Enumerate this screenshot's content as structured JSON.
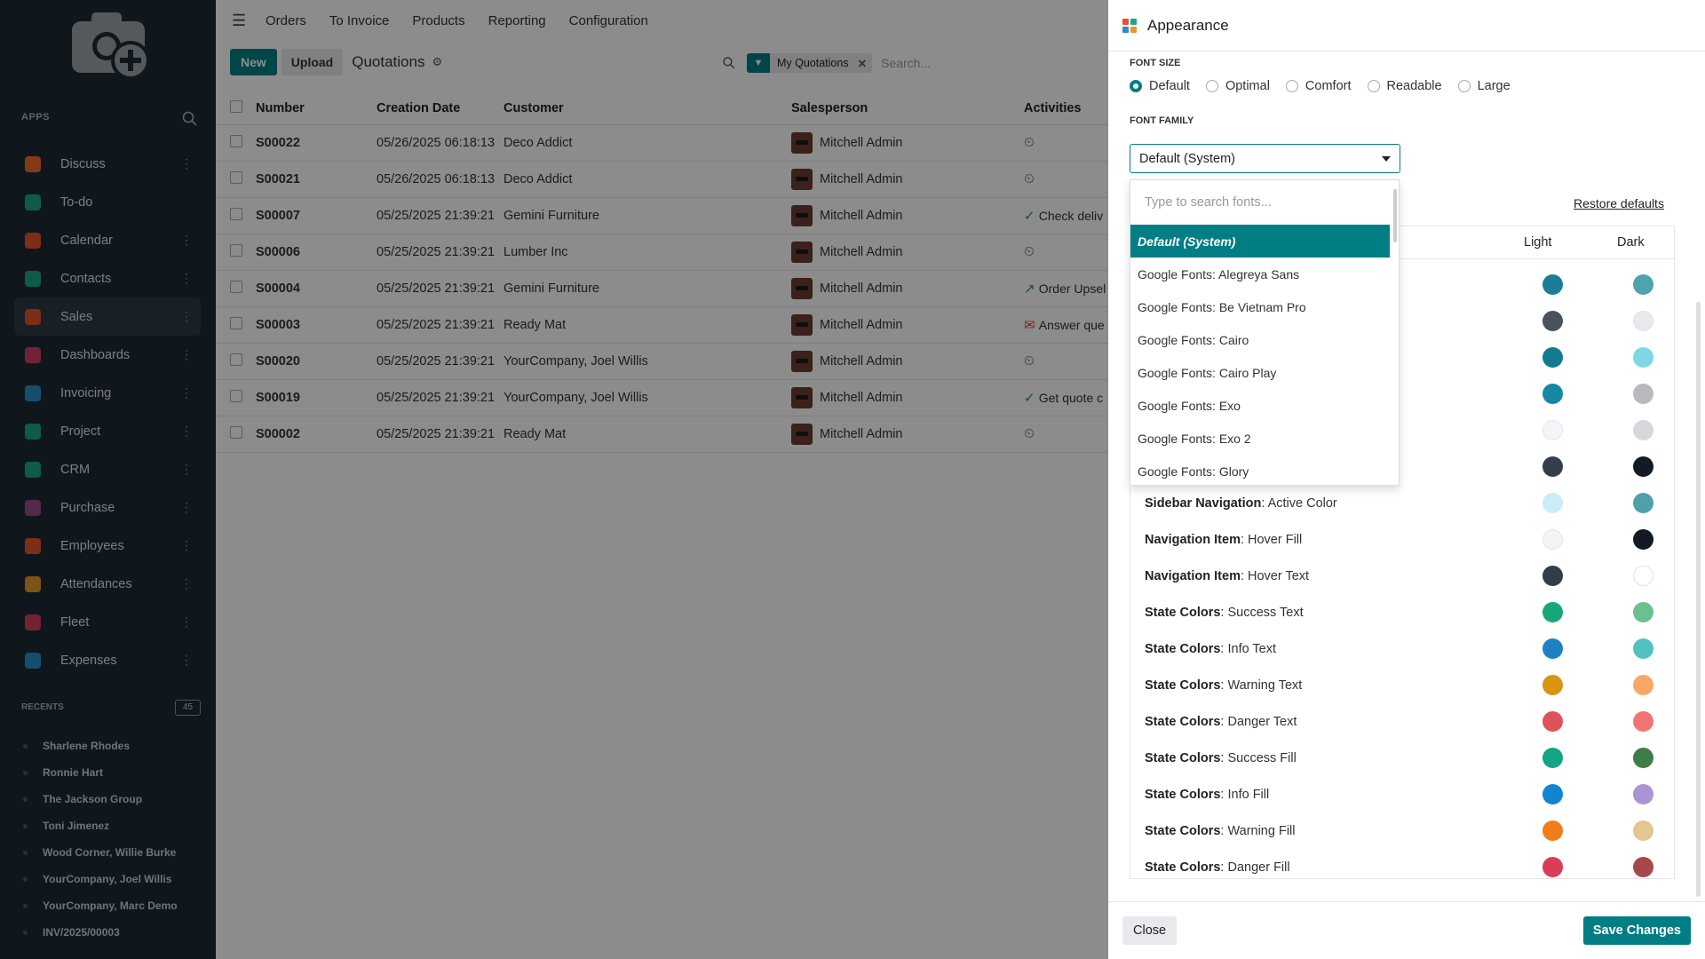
{
  "sidebar": {
    "apps_title": "APPS",
    "apps": [
      {
        "label": "Discuss",
        "color": "#f06a2a",
        "dots": true
      },
      {
        "label": "To-do",
        "color": "#1aa58c",
        "dots": false
      },
      {
        "label": "Calendar",
        "color": "#e5532e",
        "dots": true
      },
      {
        "label": "Contacts",
        "color": "#1aa58c",
        "dots": true
      },
      {
        "label": "Sales",
        "color": "#e5532e",
        "dots": true
      },
      {
        "label": "Dashboards",
        "color": "#cf3f62",
        "dots": true
      },
      {
        "label": "Invoicing",
        "color": "#2b8ec8",
        "dots": true
      },
      {
        "label": "Project",
        "color": "#1aa58c",
        "dots": true
      },
      {
        "label": "CRM",
        "color": "#1aa58c",
        "dots": true
      },
      {
        "label": "Purchase",
        "color": "#9b4a8f",
        "dots": true
      },
      {
        "label": "Employees",
        "color": "#e5532e",
        "dots": true
      },
      {
        "label": "Attendances",
        "color": "#e8962a",
        "dots": true
      },
      {
        "label": "Fleet",
        "color": "#cf3f62",
        "dots": true
      },
      {
        "label": "Expenses",
        "color": "#2b8ec8",
        "dots": true
      }
    ],
    "recents_title": "RECENTS",
    "recents_count": "45",
    "recents": [
      "Sharlene Rhodes",
      "Ronnie Hart",
      "The Jackson Group",
      "Toni Jimenez",
      "Wood Corner, Willie Burke",
      "YourCompany, Joel Willis",
      "YourCompany, Marc Demo",
      "INV/2025/00003"
    ]
  },
  "topbar": {
    "menus": [
      "Orders",
      "To Invoice",
      "Products",
      "Reporting",
      "Configuration"
    ]
  },
  "controls": {
    "new_label": "New",
    "upload_label": "Upload",
    "title": "Quotations",
    "facet_label": "My Quotations",
    "search_placeholder": "Search..."
  },
  "table": {
    "headers": [
      "Number",
      "Creation Date",
      "Customer",
      "Salesperson",
      "Activities"
    ],
    "rows": [
      {
        "number": "S00022",
        "date": "05/26/2025 06:18:13",
        "customer": "Deco Addict",
        "salesperson": "Mitchell Admin",
        "activity": ""
      },
      {
        "number": "S00021",
        "date": "05/26/2025 06:18:13",
        "customer": "Deco Addict",
        "salesperson": "Mitchell Admin",
        "activity": ""
      },
      {
        "number": "S00007",
        "date": "05/25/2025 21:39:21",
        "customer": "Gemini Furniture",
        "salesperson": "Mitchell Admin",
        "activity": "Check deliv"
      },
      {
        "number": "S00006",
        "date": "05/25/2025 21:39:21",
        "customer": "Lumber Inc",
        "salesperson": "Mitchell Admin",
        "activity": ""
      },
      {
        "number": "S00004",
        "date": "05/25/2025 21:39:21",
        "customer": "Gemini Furniture",
        "salesperson": "Mitchell Admin",
        "activity": "Order Upsel"
      },
      {
        "number": "S00003",
        "date": "05/25/2025 21:39:21",
        "customer": "Ready Mat",
        "salesperson": "Mitchell Admin",
        "activity": "Answer que"
      },
      {
        "number": "S00020",
        "date": "05/25/2025 21:39:21",
        "customer": "YourCompany, Joel Willis",
        "salesperson": "Mitchell Admin",
        "activity": ""
      },
      {
        "number": "S00019",
        "date": "05/25/2025 21:39:21",
        "customer": "YourCompany, Joel Willis",
        "salesperson": "Mitchell Admin",
        "activity": "Get quote c"
      },
      {
        "number": "S00002",
        "date": "05/25/2025 21:39:21",
        "customer": "Ready Mat",
        "salesperson": "Mitchell Admin",
        "activity": ""
      }
    ]
  },
  "panel": {
    "title": "Appearance",
    "font_size_label": "FONT SIZE",
    "font_sizes": [
      "Default",
      "Optimal",
      "Comfort",
      "Readable",
      "Large"
    ],
    "font_size_selected": "Default",
    "font_family_label": "FONT FAMILY",
    "font_family_value": "Default (System)",
    "restore_label": "Restore defaults",
    "col_light": "Light",
    "col_dark": "Dark",
    "colors": [
      {
        "group": "",
        "name": "",
        "light": "#1a7e99",
        "dark": "#4fa3ad"
      },
      {
        "group": "",
        "name": "",
        "light": "#4a525c",
        "dark": "#e8e9ee"
      },
      {
        "group": "",
        "name": "",
        "light": "#137a90",
        "dark": "#7fd6e6"
      },
      {
        "group": "",
        "name": "",
        "light": "#1787a6",
        "dark": "#b8b8bd"
      },
      {
        "group": "",
        "name": "",
        "light": "#f3f5f9",
        "dark": "#d6d8de"
      },
      {
        "group": "",
        "name": "",
        "light": "#343d4a",
        "dark": "#121a27"
      },
      {
        "group": "Sidebar Navigation",
        "name": ": Active Color",
        "light": "#c9edf6",
        "dark": "#4ea0ab"
      },
      {
        "group": "Navigation Item",
        "name": ": Hover Fill",
        "light": "#f3f4f6",
        "dark": "#141a24"
      },
      {
        "group": "Navigation Item",
        "name": ": Hover Text",
        "light": "#333d4a",
        "dark": "#ffffff"
      },
      {
        "group": "State Colors",
        "name": ": Success Text",
        "light": "#16a77a",
        "dark": "#6cbf8e"
      },
      {
        "group": "State Colors",
        "name": ": Info Text",
        "light": "#1d82c4",
        "dark": "#52c1c1"
      },
      {
        "group": "State Colors",
        "name": ": Warning Text",
        "light": "#d99512",
        "dark": "#f7a866"
      },
      {
        "group": "State Colors",
        "name": ": Danger Text",
        "light": "#e0525a",
        "dark": "#f07575"
      },
      {
        "group": "State Colors",
        "name": ": Success Fill",
        "light": "#13a585",
        "dark": "#3f7d46"
      },
      {
        "group": "State Colors",
        "name": ": Info Fill",
        "light": "#1285d2",
        "dark": "#a995d5"
      },
      {
        "group": "State Colors",
        "name": ": Warning Fill",
        "light": "#f07c1a",
        "dark": "#e3c690"
      },
      {
        "group": "State Colors",
        "name": ": Danger Fill",
        "light": "#da3d57",
        "dark": "#a6474a"
      }
    ],
    "close_label": "Close",
    "save_label": "Save Changes"
  },
  "dropdown": {
    "search_placeholder": "Type to search fonts...",
    "items": [
      "Default (System)",
      "Google Fonts: Alegreya Sans",
      "Google Fonts: Be Vietnam Pro",
      "Google Fonts: Cairo",
      "Google Fonts: Cairo Play",
      "Google Fonts: Exo",
      "Google Fonts: Exo 2",
      "Google Fonts: Glory"
    ],
    "selected_index": 0
  }
}
